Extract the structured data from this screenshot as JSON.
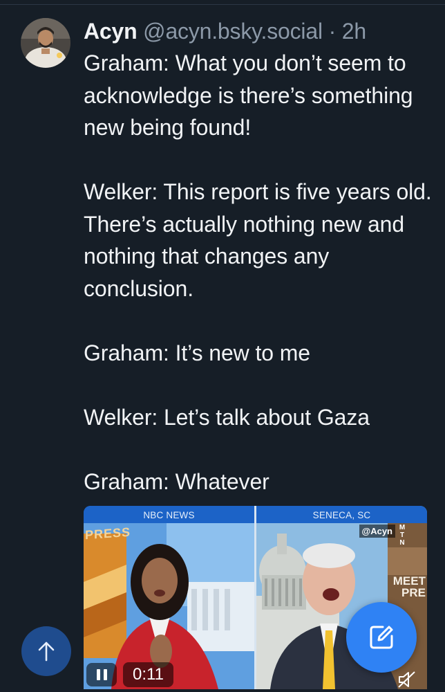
{
  "post": {
    "author": {
      "display_name": "Acyn",
      "handle": "@acyn.bsky.social",
      "separator": "·",
      "time": "2h"
    },
    "paragraphs": [
      "Graham: What you don’t seem to acknowledge is there’s something new being found!",
      "Welker: This report is five years old. There’s actually nothing new and nothing that changes any conclusion.",
      "Graham: It’s new to me",
      "Welker: Let’s talk about Gaza",
      "Graham: Whatever"
    ]
  },
  "video": {
    "left_banner": "NBC NEWS",
    "right_banner": "SENECA, SC",
    "credit": "@Acyn",
    "mtn_logo": [
      "M",
      "T",
      "N"
    ],
    "elapsed": "0:11",
    "state": "playing",
    "muted": true,
    "set_text_left": "PRESS",
    "set_text_right": "MEET",
    "set_text_right_sub": "PRE"
  },
  "controls": {
    "scroll_top_icon": "arrow-up-icon",
    "compose_icon": "compose-icon",
    "pause_icon": "pause-icon",
    "mute_icon": "muted-speaker-icon"
  },
  "colors": {
    "background": "#161e27",
    "text": "#f1f3f5",
    "muted_text": "#8c99a8",
    "accent": "#2f82f4",
    "scroll_top": "#1f4c8e"
  }
}
